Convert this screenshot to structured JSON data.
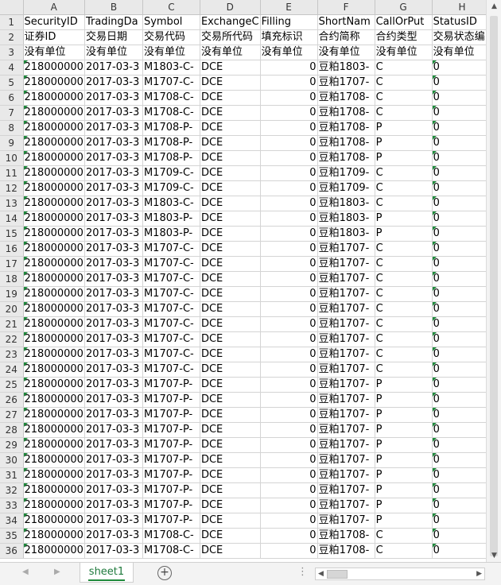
{
  "columns": [
    "A",
    "B",
    "C",
    "D",
    "E",
    "F",
    "G",
    "H"
  ],
  "rows": [
    {
      "n": "1",
      "cells": [
        "SecurityID",
        "TradingDa",
        "Symbol",
        "ExchangeC",
        "Filling",
        "ShortNam",
        "CallOrPut",
        "StatusID"
      ]
    },
    {
      "n": "2",
      "cells": [
        "证券ID",
        "交易日期",
        "交易代码",
        "交易所代码",
        "填充标识",
        "合约简称",
        "合约类型",
        "交易状态编"
      ]
    },
    {
      "n": "3",
      "cells": [
        "没有单位",
        "没有单位",
        "没有单位",
        "没有单位",
        "没有单位",
        "没有单位",
        "没有单位",
        "没有单位"
      ]
    },
    {
      "n": "4",
      "cells": [
        "218000000",
        "2017-03-3",
        "M1803-C-",
        "DCE",
        "0",
        "豆粕1803-",
        "C",
        "0"
      ]
    },
    {
      "n": "5",
      "cells": [
        "218000000",
        "2017-03-3",
        "M1707-C-",
        "DCE",
        "0",
        "豆粕1707-",
        "C",
        "0"
      ]
    },
    {
      "n": "6",
      "cells": [
        "218000000",
        "2017-03-3",
        "M1708-C-",
        "DCE",
        "0",
        "豆粕1708-",
        "C",
        "0"
      ]
    },
    {
      "n": "7",
      "cells": [
        "218000000",
        "2017-03-3",
        "M1708-C-",
        "DCE",
        "0",
        "豆粕1708-",
        "C",
        "0"
      ]
    },
    {
      "n": "8",
      "cells": [
        "218000000",
        "2017-03-3",
        "M1708-P-",
        "DCE",
        "0",
        "豆粕1708-",
        "P",
        "0"
      ]
    },
    {
      "n": "9",
      "cells": [
        "218000000",
        "2017-03-3",
        "M1708-P-",
        "DCE",
        "0",
        "豆粕1708-",
        "P",
        "0"
      ]
    },
    {
      "n": "10",
      "cells": [
        "218000000",
        "2017-03-3",
        "M1708-P-",
        "DCE",
        "0",
        "豆粕1708-",
        "P",
        "0"
      ]
    },
    {
      "n": "11",
      "cells": [
        "218000000",
        "2017-03-3",
        "M1709-C-",
        "DCE",
        "0",
        "豆粕1709-",
        "C",
        "0"
      ]
    },
    {
      "n": "12",
      "cells": [
        "218000000",
        "2017-03-3",
        "M1709-C-",
        "DCE",
        "0",
        "豆粕1709-",
        "C",
        "0"
      ]
    },
    {
      "n": "13",
      "cells": [
        "218000000",
        "2017-03-3",
        "M1803-C-",
        "DCE",
        "0",
        "豆粕1803-",
        "C",
        "0"
      ]
    },
    {
      "n": "14",
      "cells": [
        "218000000",
        "2017-03-3",
        "M1803-P-",
        "DCE",
        "0",
        "豆粕1803-",
        "P",
        "0"
      ]
    },
    {
      "n": "15",
      "cells": [
        "218000000",
        "2017-03-3",
        "M1803-P-",
        "DCE",
        "0",
        "豆粕1803-",
        "P",
        "0"
      ]
    },
    {
      "n": "16",
      "cells": [
        "218000000",
        "2017-03-3",
        "M1707-C-",
        "DCE",
        "0",
        "豆粕1707-",
        "C",
        "0"
      ]
    },
    {
      "n": "17",
      "cells": [
        "218000000",
        "2017-03-3",
        "M1707-C-",
        "DCE",
        "0",
        "豆粕1707-",
        "C",
        "0"
      ]
    },
    {
      "n": "18",
      "cells": [
        "218000000",
        "2017-03-3",
        "M1707-C-",
        "DCE",
        "0",
        "豆粕1707-",
        "C",
        "0"
      ]
    },
    {
      "n": "19",
      "cells": [
        "218000000",
        "2017-03-3",
        "M1707-C-",
        "DCE",
        "0",
        "豆粕1707-",
        "C",
        "0"
      ]
    },
    {
      "n": "20",
      "cells": [
        "218000000",
        "2017-03-3",
        "M1707-C-",
        "DCE",
        "0",
        "豆粕1707-",
        "C",
        "0"
      ]
    },
    {
      "n": "21",
      "cells": [
        "218000000",
        "2017-03-3",
        "M1707-C-",
        "DCE",
        "0",
        "豆粕1707-",
        "C",
        "0"
      ]
    },
    {
      "n": "22",
      "cells": [
        "218000000",
        "2017-03-3",
        "M1707-C-",
        "DCE",
        "0",
        "豆粕1707-",
        "C",
        "0"
      ]
    },
    {
      "n": "23",
      "cells": [
        "218000000",
        "2017-03-3",
        "M1707-C-",
        "DCE",
        "0",
        "豆粕1707-",
        "C",
        "0"
      ]
    },
    {
      "n": "24",
      "cells": [
        "218000000",
        "2017-03-3",
        "M1707-C-",
        "DCE",
        "0",
        "豆粕1707-",
        "C",
        "0"
      ]
    },
    {
      "n": "25",
      "cells": [
        "218000000",
        "2017-03-3",
        "M1707-P-",
        "DCE",
        "0",
        "豆粕1707-",
        "P",
        "0"
      ]
    },
    {
      "n": "26",
      "cells": [
        "218000000",
        "2017-03-3",
        "M1707-P-",
        "DCE",
        "0",
        "豆粕1707-",
        "P",
        "0"
      ]
    },
    {
      "n": "27",
      "cells": [
        "218000000",
        "2017-03-3",
        "M1707-P-",
        "DCE",
        "0",
        "豆粕1707-",
        "P",
        "0"
      ]
    },
    {
      "n": "28",
      "cells": [
        "218000000",
        "2017-03-3",
        "M1707-P-",
        "DCE",
        "0",
        "豆粕1707-",
        "P",
        "0"
      ]
    },
    {
      "n": "29",
      "cells": [
        "218000000",
        "2017-03-3",
        "M1707-P-",
        "DCE",
        "0",
        "豆粕1707-",
        "P",
        "0"
      ]
    },
    {
      "n": "30",
      "cells": [
        "218000000",
        "2017-03-3",
        "M1707-P-",
        "DCE",
        "0",
        "豆粕1707-",
        "P",
        "0"
      ]
    },
    {
      "n": "31",
      "cells": [
        "218000000",
        "2017-03-3",
        "M1707-P-",
        "DCE",
        "0",
        "豆粕1707-",
        "P",
        "0"
      ]
    },
    {
      "n": "32",
      "cells": [
        "218000000",
        "2017-03-3",
        "M1707-P-",
        "DCE",
        "0",
        "豆粕1707-",
        "P",
        "0"
      ]
    },
    {
      "n": "33",
      "cells": [
        "218000000",
        "2017-03-3",
        "M1707-P-",
        "DCE",
        "0",
        "豆粕1707-",
        "P",
        "0"
      ]
    },
    {
      "n": "34",
      "cells": [
        "218000000",
        "2017-03-3",
        "M1707-P-",
        "DCE",
        "0",
        "豆粕1707-",
        "P",
        "0"
      ]
    },
    {
      "n": "35",
      "cells": [
        "218000000",
        "2017-03-3",
        "M1708-C-",
        "DCE",
        "0",
        "豆粕1708-",
        "C",
        "0"
      ]
    },
    {
      "n": "36",
      "cells": [
        "218000000",
        "2017-03-3",
        "M1708-C-",
        "DCE",
        "0",
        "豆粕1708-",
        "C",
        "0"
      ]
    }
  ],
  "sheet_tab": "sheet1",
  "add_sheet_symbol": "+",
  "more_symbol": "⋮",
  "nav_prev": "◀",
  "nav_next": "▶",
  "icons": {
    "add_sheet": "plus-circle-icon",
    "scroll_up": "arrow-up-icon",
    "scroll_down": "arrow-down-icon",
    "scroll_left": "arrow-left-icon",
    "scroll_right": "arrow-right-icon"
  },
  "colors": {
    "accent": "#1f8a3c",
    "header_bg": "#e9e9e9",
    "grid_line": "#d4d4d4"
  }
}
